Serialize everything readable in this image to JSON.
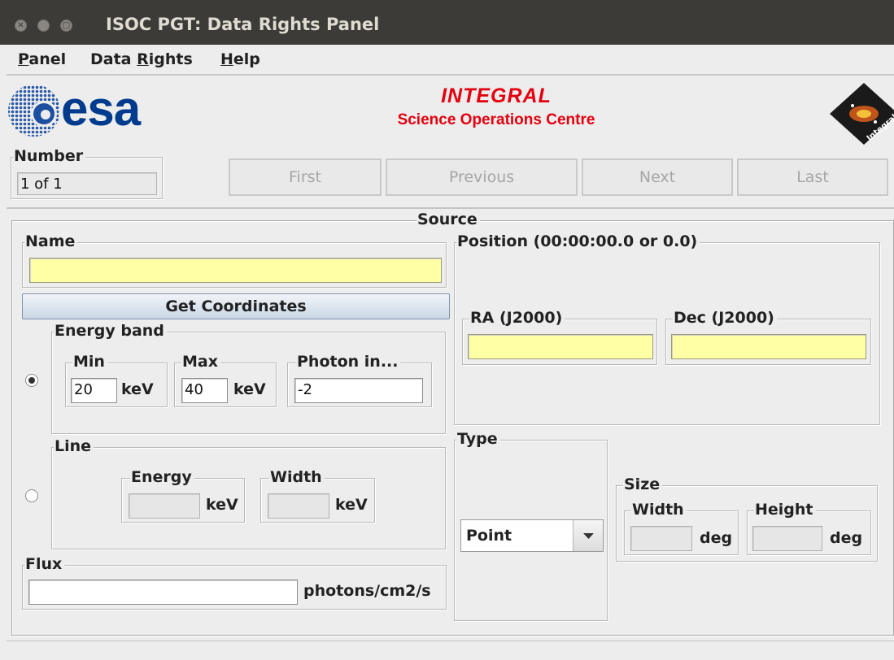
{
  "window": {
    "title": "ISOC PGT: Data Rights Panel"
  },
  "menu": {
    "panel": {
      "mnemonic": "P",
      "rest": "anel"
    },
    "data_rights": {
      "before": "Data ",
      "mnemonic": "R",
      "rest": "ights"
    },
    "help": {
      "mnemonic": "H",
      "rest": "elp"
    }
  },
  "header": {
    "esa_logo_text": "esa",
    "integral_title": "INTEGRAL",
    "integral_subtitle": "Science Operations Centre",
    "integral_logo_text": "Integral"
  },
  "number": {
    "label": "Number",
    "value": "1 of 1"
  },
  "nav": {
    "first": "First",
    "previous": "Previous",
    "next": "Next",
    "last": "Last"
  },
  "source": {
    "title": "Source",
    "name": {
      "label": "Name",
      "value": ""
    },
    "get_coordinates": "Get Coordinates",
    "energy_band": {
      "label": "Energy band",
      "selected": true,
      "min": {
        "label": "Min",
        "value": "20",
        "unit": "keV"
      },
      "max": {
        "label": "Max",
        "value": "40",
        "unit": "keV"
      },
      "photon_index": {
        "label": "Photon in...",
        "value": "-2"
      }
    },
    "line": {
      "label": "Line",
      "selected": false,
      "energy": {
        "label": "Energy",
        "value": "",
        "unit": "keV"
      },
      "width": {
        "label": "Width",
        "value": "",
        "unit": "keV"
      }
    },
    "flux": {
      "label": "Flux",
      "value": "",
      "unit": "photons/cm2/s"
    },
    "position": {
      "label": "Position (00:00:00.0 or 0.0)",
      "ra": {
        "label": "RA (J2000)",
        "value": ""
      },
      "dec": {
        "label": "Dec (J2000)",
        "value": ""
      }
    },
    "type": {
      "label": "Type",
      "selected": "Point"
    },
    "size": {
      "label": "Size",
      "width": {
        "label": "Width",
        "value": "",
        "unit": "deg"
      },
      "height": {
        "label": "Height",
        "value": "",
        "unit": "deg"
      }
    }
  },
  "colors": {
    "required_field": "#ffffa5",
    "integral_red": "#e3000f",
    "esa_blue": "#003b8e",
    "titlebar": "#3c3b37"
  }
}
